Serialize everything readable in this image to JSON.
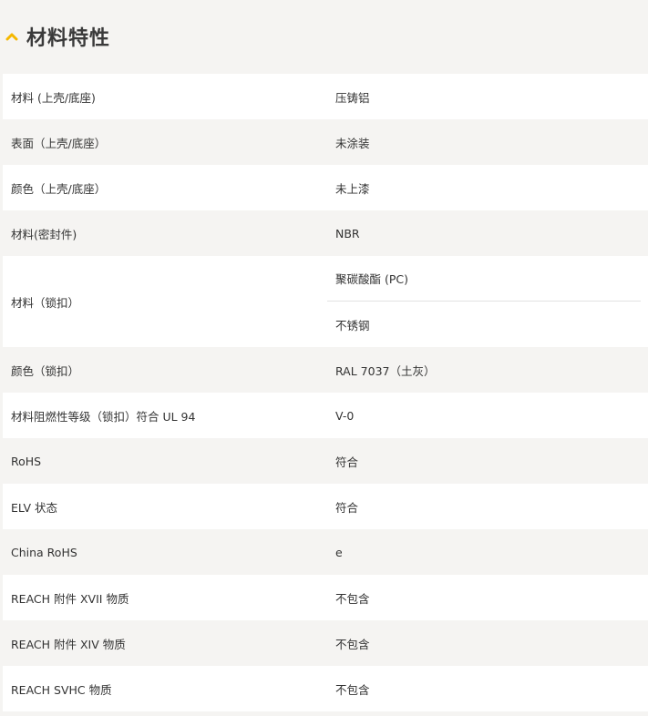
{
  "section": {
    "title": "材料特性",
    "chevron_icon": "chevron-up-icon",
    "accent_color": "#f5b800"
  },
  "rows": [
    {
      "key": "材料 (上壳/底座)",
      "value": "压铸铝"
    },
    {
      "key": "表面（上壳/底座）",
      "value": "未涂装"
    },
    {
      "key": "颜色（上壳/底座）",
      "value": "未上漆"
    },
    {
      "key": "材料(密封件)",
      "value": "NBR"
    },
    {
      "key": "材料（锁扣）",
      "values": [
        "聚碳酸酯 (PC)",
        "不锈钢"
      ]
    },
    {
      "key": "颜色（锁扣）",
      "value": "RAL 7037（土灰）"
    },
    {
      "key": "材料阻燃性等级（锁扣）符合 UL 94",
      "value": "V-0"
    },
    {
      "key": "RoHS",
      "value": "符合"
    },
    {
      "key": "ELV 状态",
      "value": "符合"
    },
    {
      "key": "China RoHS",
      "value": "e"
    },
    {
      "key": "REACH 附件 XVII 物质",
      "value": "不包含"
    },
    {
      "key": "REACH 附件 XIV 物质",
      "value": "不包含"
    },
    {
      "key": "REACH SVHC 物质",
      "value": "不包含"
    }
  ]
}
